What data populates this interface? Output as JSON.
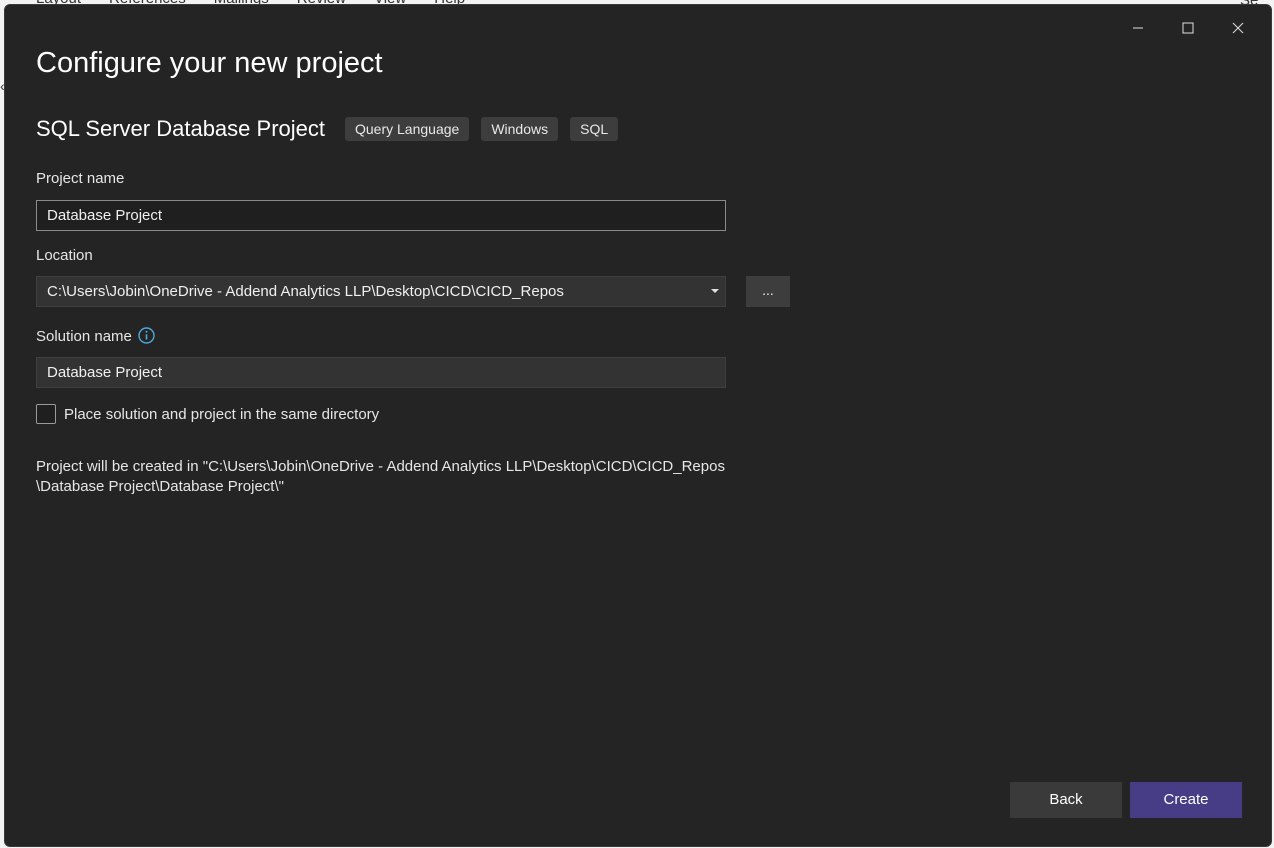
{
  "background": {
    "menu_items": [
      "Layout",
      "References",
      "Mailings",
      "Review",
      "View",
      "Help"
    ],
    "right_text": "Se"
  },
  "window": {
    "controls": [
      "minimize-icon",
      "maximize-icon",
      "close-icon"
    ]
  },
  "header": {
    "title": "Configure your new project",
    "template_name": "SQL Server Database Project",
    "tags": [
      "Query Language",
      "Windows",
      "SQL"
    ]
  },
  "form": {
    "project_name": {
      "label": "Project name",
      "value": "Database Project"
    },
    "location": {
      "label": "Location",
      "value": "C:\\Users\\Jobin\\OneDrive - Addend Analytics LLP\\Desktop\\CICD\\CICD_Repos",
      "browse_label": "..."
    },
    "solution_name": {
      "label": "Solution name",
      "value": "Database Project",
      "info_icon": "info-icon"
    },
    "same_directory": {
      "label": "Place solution and project in the same directory",
      "checked": false
    },
    "path_info": {
      "line1": "Project will be created in \"C:\\Users\\Jobin\\OneDrive - Addend Analytics LLP\\Desktop\\CICD\\CICD_Repos",
      "line2": "\\Database Project\\Database Project\\\""
    }
  },
  "footer": {
    "back_label": "Back",
    "create_label": "Create"
  },
  "colors": {
    "dialog_bg": "#242424",
    "accent": "#463d86",
    "info_icon": "#4fa8dc"
  }
}
